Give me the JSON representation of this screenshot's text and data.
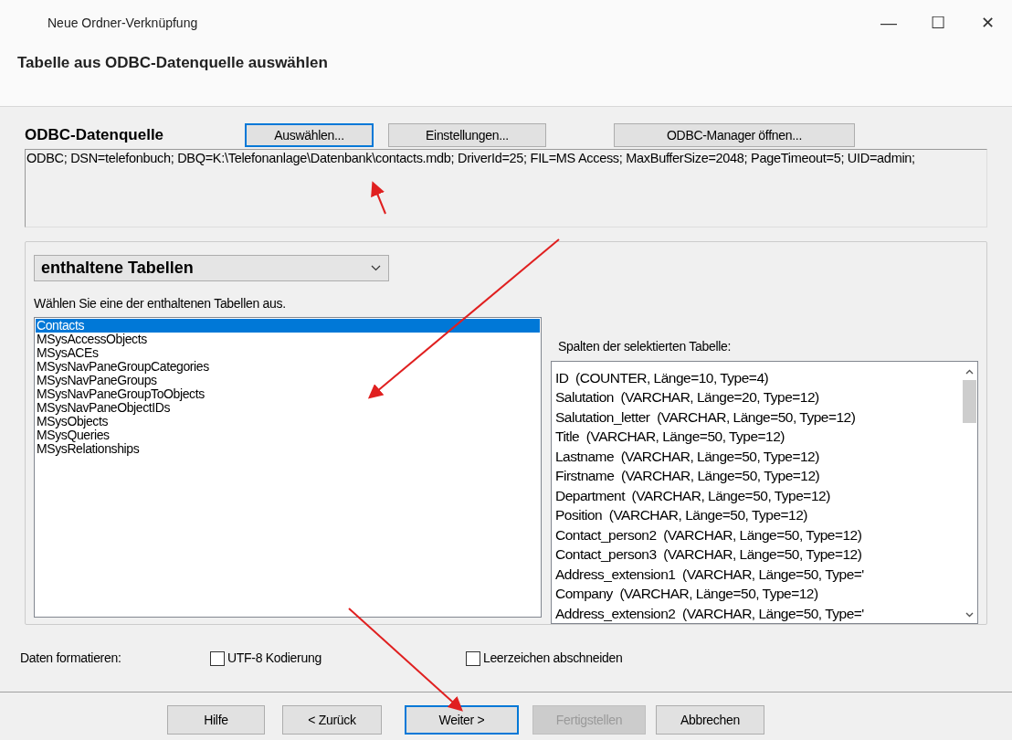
{
  "window": {
    "title": "Neue Ordner-Verknüpfung",
    "controls": [
      "—",
      "☐",
      "✕"
    ]
  },
  "heading": "Tabelle aus ODBC-Datenquelle auswählen",
  "source": {
    "label": "ODBC-Datenquelle",
    "buttons": [
      {
        "label": "Auswählen...",
        "focused": true
      },
      {
        "label": "Einstellungen...",
        "focused": false
      },
      {
        "label": "ODBC-Manager öffnen...",
        "focused": false
      }
    ],
    "connection": "ODBC; DSN=telefonbuch; DBQ=K:\\Telefonanlage\\Datenbank\\contacts.mdb; DriverId=25; FIL=MS Access; MaxBufferSize=2048; PageTimeout=5; UID=admin;"
  },
  "group": {
    "dropdown": "enthaltene Tabellen",
    "hint": "Wählen Sie eine der enthaltenen Tabellen aus.",
    "tables": [
      {
        "name": "Contacts",
        "selected": true
      },
      {
        "name": "MSysAccessObjects",
        "selected": false
      },
      {
        "name": "MSysACEs",
        "selected": false
      },
      {
        "name": "MSysNavPaneGroupCategories",
        "selected": false
      },
      {
        "name": "MSysNavPaneGroups",
        "selected": false
      },
      {
        "name": "MSysNavPaneGroupToObjects",
        "selected": false
      },
      {
        "name": "MSysNavPaneObjectIDs",
        "selected": false
      },
      {
        "name": "MSysObjects",
        "selected": false
      },
      {
        "name": "MSysQueries",
        "selected": false
      },
      {
        "name": "MSysRelationships",
        "selected": false
      }
    ],
    "columns_label": "Spalten der selektierten Tabelle:",
    "columns": [
      "ID  (COUNTER, Länge=10, Type=4)",
      "Salutation  (VARCHAR, Länge=20, Type=12)",
      "Salutation_letter  (VARCHAR, Länge=50, Type=12)",
      "Title  (VARCHAR, Länge=50, Type=12)",
      "Lastname  (VARCHAR, Länge=50, Type=12)",
      "Firstname  (VARCHAR, Länge=50, Type=12)",
      "Department  (VARCHAR, Länge=50, Type=12)",
      "Position  (VARCHAR, Länge=50, Type=12)",
      "Contact_person2  (VARCHAR, Länge=50, Type=12)",
      "Contact_person3  (VARCHAR, Länge=50, Type=12)",
      "Address_extension1  (VARCHAR, Länge=50, Type='",
      "Company  (VARCHAR, Länge=50, Type=12)",
      "Address_extension2  (VARCHAR, Länge=50, Type='"
    ]
  },
  "format": {
    "label": "Daten formatieren:",
    "options": [
      {
        "label": "UTF-8 Kodierung",
        "checked": false
      },
      {
        "label": "Leerzeichen abschneiden",
        "checked": false
      }
    ]
  },
  "buttons": [
    {
      "label": "Hilfe",
      "focused": false,
      "disabled": false
    },
    {
      "label": "< Zurück",
      "focused": false,
      "disabled": false
    },
    {
      "label": "Weiter >",
      "focused": true,
      "disabled": false
    },
    {
      "label": "Fertigstellen",
      "focused": false,
      "disabled": true
    },
    {
      "label": "Abbrechen",
      "focused": false,
      "disabled": false
    }
  ]
}
